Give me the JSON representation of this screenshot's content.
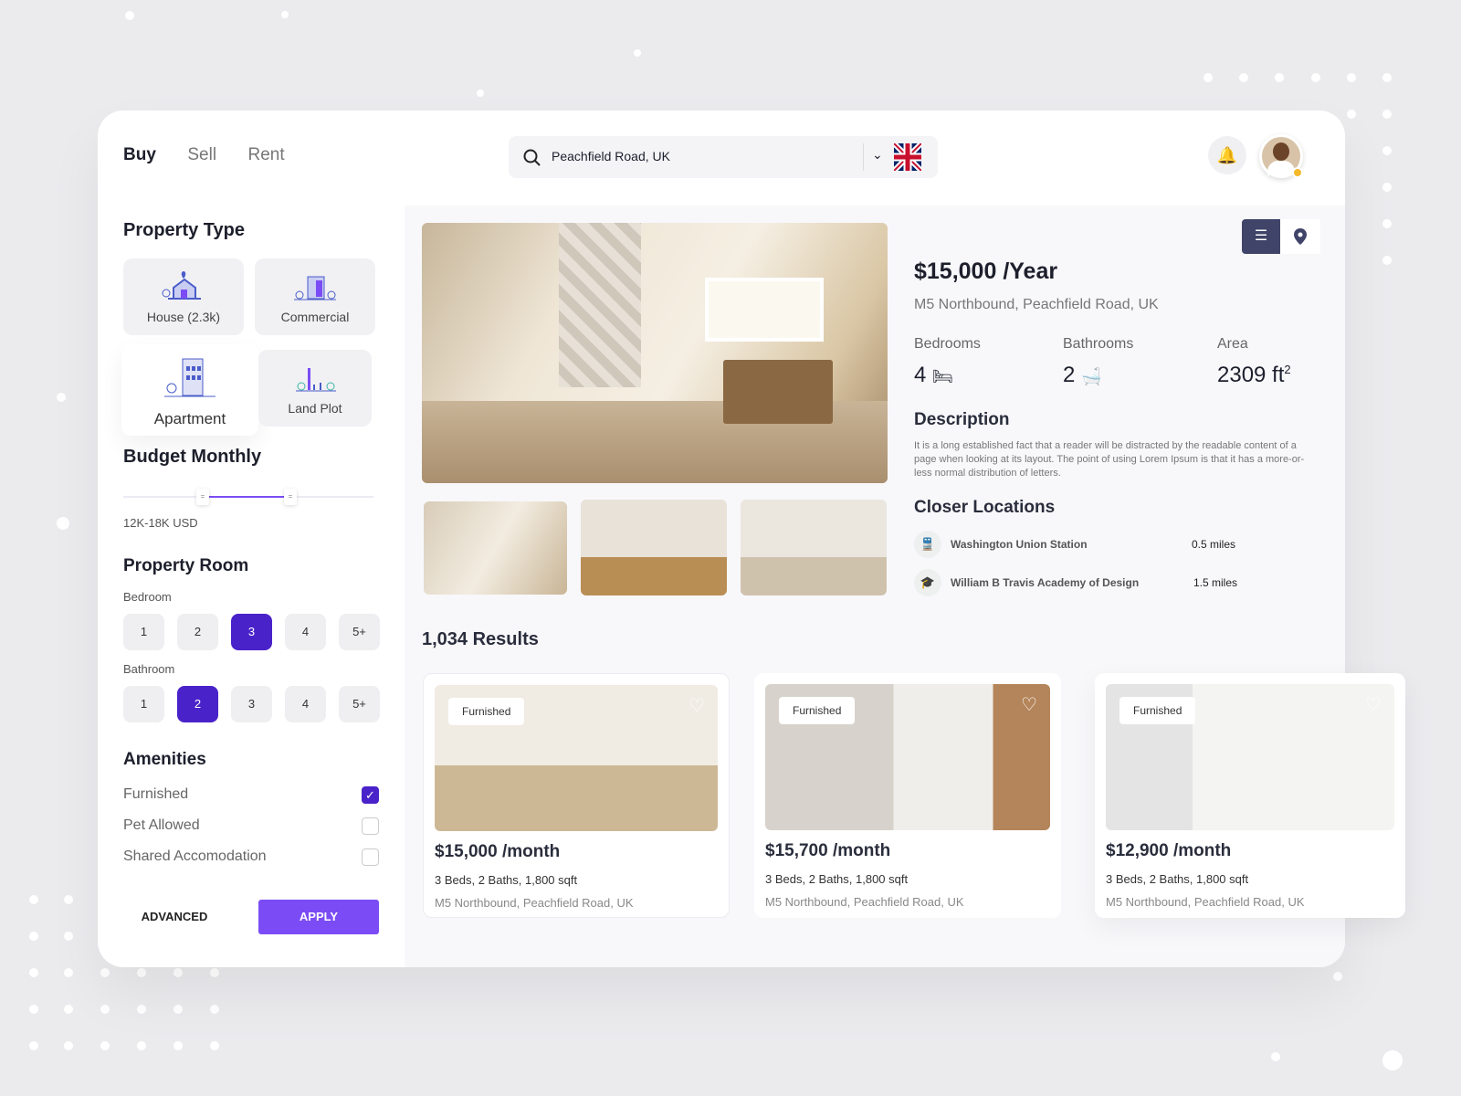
{
  "nav": {
    "tabs": [
      "Buy",
      "Sell",
      "Rent"
    ],
    "active": "Buy"
  },
  "search": {
    "value": "Peachfield Road, UK",
    "flag": "UK"
  },
  "filters": {
    "property_type_title": "Property Type",
    "types": [
      "House (2.3k)",
      "Commercial",
      "Apartment",
      "Land Plot"
    ],
    "selected_type": "Apartment",
    "budget_title": "Budget Monthly",
    "budget_value": "12K-18K USD",
    "budget_range_fraction": [
      0.33,
      0.67
    ],
    "room_title": "Property Room",
    "bedroom_label": "Bedroom",
    "bathroom_label": "Bathroom",
    "options": [
      "1",
      "2",
      "3",
      "4",
      "5+"
    ],
    "bedroom_selected": "3",
    "bathroom_selected": "2",
    "amenities_title": "Amenities",
    "amenities": [
      {
        "label": "Furnished",
        "checked": true
      },
      {
        "label": "Pet Allowed",
        "checked": false
      },
      {
        "label": "Shared Accomodation",
        "checked": false
      }
    ],
    "advanced": "ADVANCED",
    "apply": "APPLY"
  },
  "detail": {
    "price": "$15,000 /Year",
    "address": "M5 Northbound, Peachfield Road, UK",
    "bedrooms_label": "Bedrooms",
    "bedrooms": "4",
    "bathrooms_label": "Bathrooms",
    "bathrooms": "2",
    "area_label": "Area",
    "area": "2309 ft",
    "area_sup": "2",
    "description_title": "Description",
    "description": "It is a long established fact that a reader will be distracted by the readable content of a page when looking at its layout. The point of using Lorem Ipsum is that it has a more-or-less normal distribution of letters.",
    "locations_title": "Closer Locations",
    "locations": [
      {
        "name": "Washington Union Station",
        "distance": "0.5 miles"
      },
      {
        "name": "William B Travis Academy of Design",
        "distance": "1.5 miles"
      }
    ]
  },
  "results": {
    "count": "1,034 Results",
    "cards": [
      {
        "badge": "Furnished",
        "price": "$15,000 /month",
        "spec": "3 Beds, 2 Baths, 1,800 sqft",
        "address": "M5 Northbound, Peachfield Road, UK"
      },
      {
        "badge": "Furnished",
        "price": "$15,700 /month",
        "spec": "3 Beds, 2 Baths, 1,800 sqft",
        "address": "M5 Northbound, Peachfield Road, UK"
      },
      {
        "badge": "Furnished",
        "price": "$12,900 /month",
        "spec": "3 Beds, 2 Baths, 1,800 sqft",
        "address": "M5 Northbound, Peachfield Road, UK"
      }
    ]
  },
  "colors": {
    "accent": "#4a22c9",
    "apply": "#7b4cf5",
    "view_toggle": "#3f4468"
  }
}
